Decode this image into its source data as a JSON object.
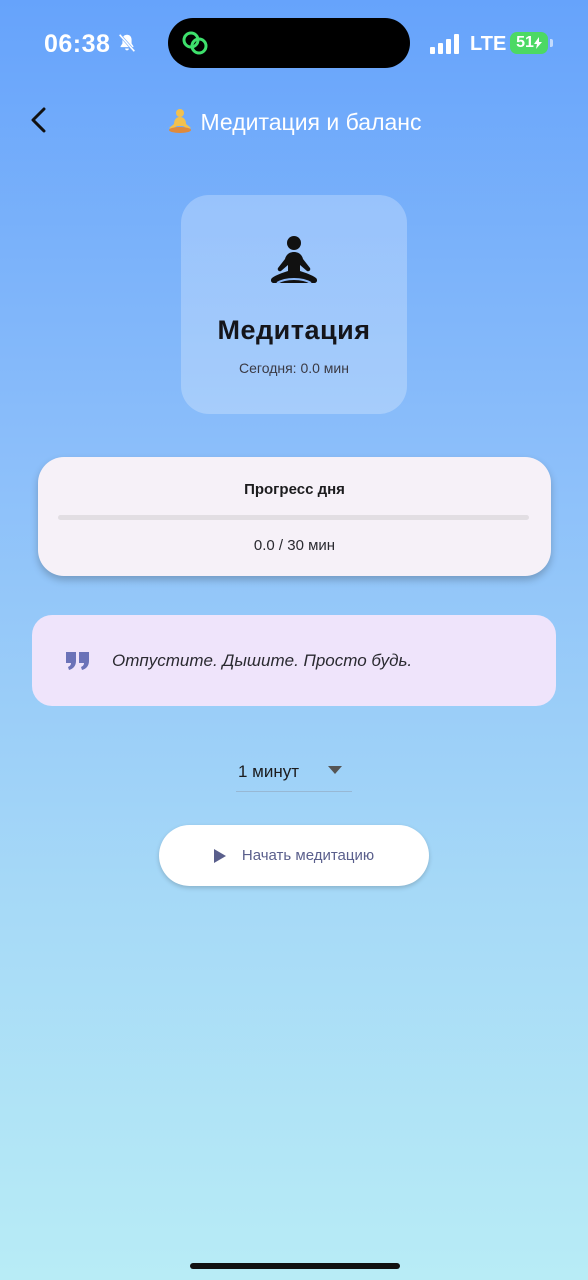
{
  "status_bar": {
    "time": "06:38",
    "network": "LTE",
    "battery": "51",
    "icons": [
      "bell-slash-icon",
      "linked-rings-icon",
      "signal-icon",
      "battery-charging-icon"
    ]
  },
  "header": {
    "back_icon": "chevron-left-icon",
    "title_emoji": "lotus-position-icon",
    "title": "Медитация и баланс"
  },
  "meditation_card": {
    "icon": "meditation-figure-icon",
    "title": "Медитация",
    "today": "Сегодня: 0.0 мин"
  },
  "progress_card": {
    "title": "Прогресс дня",
    "progress_fraction": 0.0,
    "text": "0.0 / 30 мин"
  },
  "quote_card": {
    "icon": "quote-icon",
    "text": "Отпустите. Дышите. Просто будь."
  },
  "duration_select": {
    "selected": "1 минут",
    "icon": "caret-down-icon"
  },
  "start_button": {
    "icon": "play-icon",
    "label": "Начать медитацию"
  },
  "colors": {
    "accent": "#5a5f8c",
    "quote_icon": "#6b72b8",
    "quote_bg": "#efe4fb",
    "progress_bg": "#f6f1f8"
  }
}
